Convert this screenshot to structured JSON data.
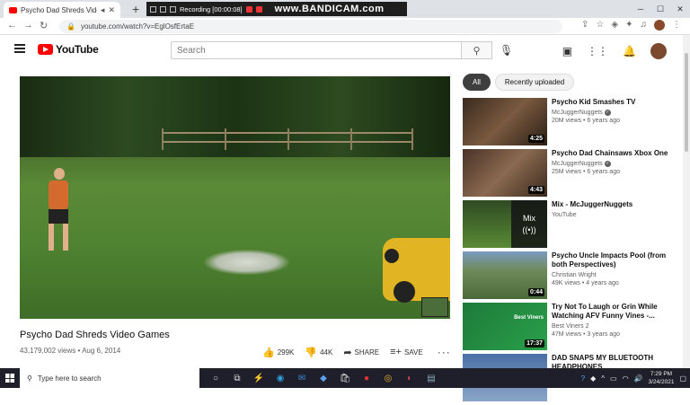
{
  "browser": {
    "tab_title": "Psycho Dad Shreds Video G...",
    "url": "youtube.com/watch?v=EglOsfErtaE",
    "recorder": {
      "status": "Recording [00:00:08]",
      "brand": "www.BANDICAM.com"
    }
  },
  "youtube": {
    "logo_text": "YouTube",
    "search_placeholder": "Search"
  },
  "video": {
    "title": "Psycho Dad Shreds Video Games",
    "meta": "43,179,002 views • Aug 6, 2014",
    "likes": "299K",
    "dislikes": "44K",
    "share_label": "SHARE",
    "save_label": "SAVE"
  },
  "chips": [
    "All",
    "Recently uploaded"
  ],
  "recommendations": [
    {
      "title": "Psycho Kid Smashes TV",
      "channel": "McJuggerNuggets",
      "verified": true,
      "stats": "20M views • 6 years ago",
      "duration": "4:25",
      "thumb_color": "#5a4636"
    },
    {
      "title": "Psycho Dad Chainsaws Xbox One",
      "channel": "McJuggerNuggets",
      "verified": true,
      "stats": "25M views • 6 years ago",
      "duration": "4:43",
      "thumb_color": "#6b4a3a"
    },
    {
      "title": "Mix - McJuggerNuggets",
      "channel": "YouTube",
      "verified": false,
      "stats": "",
      "duration": "",
      "mix_label": "Mix",
      "thumb_color": "#4a7a32"
    },
    {
      "title": "Psycho Uncle Impacts Pool (from both Perspectives)",
      "channel": "Christian Wright",
      "verified": false,
      "stats": "49K views • 4 years ago",
      "duration": "0:44",
      "thumb_color": "#6f8a5a"
    },
    {
      "title": "Try Not To Laugh or Grin While Watching AFV Funny Vines -...",
      "channel": "Best Viners 2",
      "verified": false,
      "stats": "47M views • 3 years ago",
      "duration": "17:37",
      "thumb_color": "#1e7a3a",
      "badge": "Best Viners"
    },
    {
      "title": "DAD SNAPS MY BLUETOOTH HEADPHONES",
      "channel": "",
      "verified": false,
      "stats": "",
      "duration": "",
      "thumb_color": "#4a6fa5"
    }
  ],
  "taskbar": {
    "search_placeholder": "Type here to search",
    "time": "7:29 PM",
    "date": "3/24/2021"
  }
}
